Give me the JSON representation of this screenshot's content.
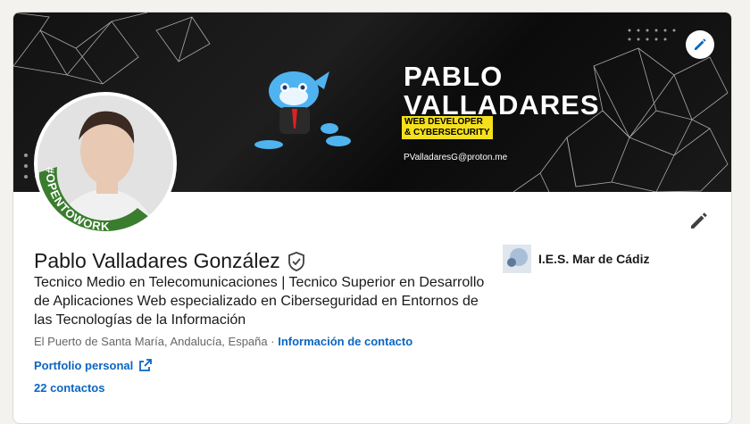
{
  "banner": {
    "name_line1": "PABLO",
    "name_line2": "VALLADARES",
    "tagline": "WEB DEVELOPER & CYBERSECURITY",
    "email": "PValladaresG@proton.me",
    "edit_icon": "pencil-icon"
  },
  "avatar": {
    "badge_text": "#OPENTOWORK",
    "badge_color": "#3a7d2e"
  },
  "profile": {
    "name": "Pablo Valladares González",
    "verified_icon": "shield-check-icon",
    "headline": "Tecnico Medio en Telecomunicaciones | Tecnico Superior en Desarrollo de Aplicaciones Web especializado en Ciberseguridad en Entornos de las Tecnologías de la Información",
    "location": "El Puerto de Santa María, Andalucía, España",
    "separator": "·",
    "contact_info": "Información de contacto",
    "portfolio": "Portfolio personal",
    "connections": "22 contactos",
    "edit_icon": "pencil-icon"
  },
  "education": {
    "school": "I.E.S. Mar de Cádiz"
  },
  "colors": {
    "accent": "#0a66c2",
    "banner_bg": "#121212",
    "tag_yellow": "#f5e01e"
  }
}
